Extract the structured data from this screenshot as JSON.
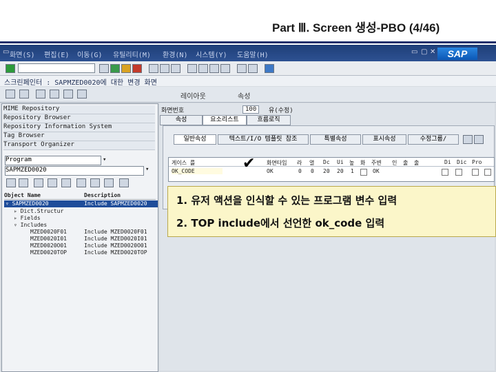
{
  "slide": {
    "title": "Part Ⅲ. Screen 생성-PBO (4/46)"
  },
  "sap": {
    "logo": "SAP",
    "menu": [
      "화면(S)",
      "편집(E)",
      "이동(G)",
      "유틸리티(M)",
      "환경(N)",
      "시스템(Y)",
      "도움말(H)"
    ],
    "screen_title": "스크린페인터 : SAPMZED0020에 대한 변경 화면",
    "toolbar2_labels": [
      "레이아웃",
      "속성"
    ]
  },
  "left": {
    "nav": [
      "MIME Repository",
      "Repository Browser",
      "Repository Information System",
      "Tag Browser",
      "Transport Organizer"
    ],
    "object_type": "Program",
    "program_name": "SAPMZED0020",
    "tree_headers": [
      "Object Name",
      "Description"
    ],
    "tree_rows": [
      [
        "SAPMZED0020",
        "Include SAPMZED0020"
      ],
      [
        "Dict.Structur",
        ""
      ],
      [
        "Fields",
        ""
      ],
      [
        "Includes",
        ""
      ],
      [
        "MZED0020F01",
        "Include MZED0020F01"
      ],
      [
        "MZED0020I01",
        "Include MZED0020I01"
      ],
      [
        "MZED0020O01",
        "Include MZED0020O01"
      ],
      [
        "MZED0020TOP",
        "Include MZED0020TOP"
      ]
    ]
  },
  "right": {
    "screen_label": "화면번호",
    "screen_number": "100",
    "screen_status": "유(수정)",
    "tabs": [
      "속성",
      "요소리스트",
      "흐름로직"
    ],
    "subtabs": [
      "일반속성",
      "텍스트/I/O 템플릿 참조",
      "특별속성",
      "표시속성",
      "수정그룹/"
    ],
    "grid_headers": [
      "게이스 를",
      "화면타입",
      "라",
      "열",
      "Dc",
      "Ui",
      "높",
      "화",
      "주변",
      "인",
      "출",
      "출",
      "",
      "Di",
      "Dic",
      "Pro"
    ],
    "grid_row": [
      "OK_CODE",
      "OK",
      "0",
      "0",
      "20",
      "20",
      "1",
      "",
      "OK"
    ]
  },
  "annotation": {
    "line1": "1. 유저 액션을 인식할 수 있는 프로그램 변수 입력",
    "line2": "2. TOP include에서 선언한 ok_code 입력"
  }
}
